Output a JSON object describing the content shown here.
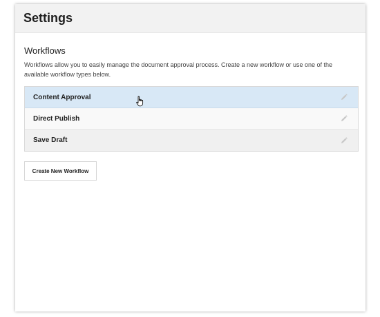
{
  "header": {
    "title": "Settings"
  },
  "workflows": {
    "title": "Workflows",
    "description": "Workflows allow you to easily manage the document approval process. Create a new workflow or use one of the available workflow types below.",
    "items": [
      {
        "label": "Content Approval",
        "icon": "pencil-icon"
      },
      {
        "label": "Direct Publish",
        "icon": "pencil-icon"
      },
      {
        "label": "Save Draft",
        "icon": "pencil-icon"
      }
    ],
    "create_button_label": "Create New Workflow"
  },
  "colors": {
    "header_bg": "#f2f2f2",
    "hover_row_bg": "#d8e8f6",
    "row_bg_alt": "#f0f0f0",
    "border": "#d9d9d9"
  }
}
